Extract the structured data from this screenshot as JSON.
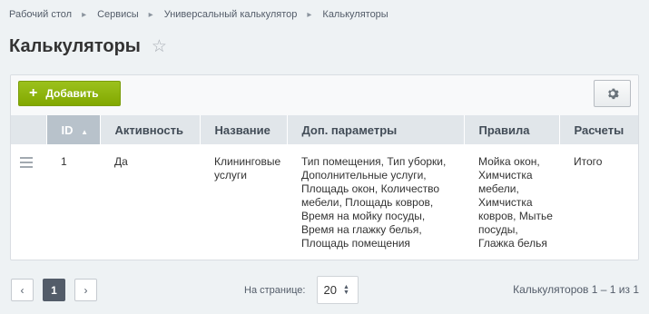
{
  "breadcrumb": [
    "Рабочий стол",
    "Сервисы",
    "Универсальный калькулятор",
    "Калькуляторы"
  ],
  "page_title": "Калькуляторы",
  "toolbar": {
    "add_label": "Добавить"
  },
  "table": {
    "columns": [
      "ID",
      "Активность",
      "Название",
      "Доп. параметры",
      "Правила",
      "Расчеты"
    ],
    "sorted_column": "ID",
    "rows": [
      {
        "id": "1",
        "active": "Да",
        "name": [
          "Клининговые",
          "услуги"
        ],
        "params": [
          "Тип помещения, Тип уборки,",
          "Дополнительные услуги,",
          "Площадь окон, Количество",
          "мебели, Площадь ковров,",
          "Время на мойку посуды,",
          "Время на глажку белья,",
          "Площадь помещения"
        ],
        "rules": [
          "Мойка окон,",
          "Химчистка",
          "мебели,",
          "Химчистка",
          "ковров, Мытье",
          "посуды,",
          "Глажка белья"
        ],
        "calcs": "Итого"
      }
    ]
  },
  "pagination": {
    "prev": "‹",
    "current_page": "1",
    "next": "›",
    "per_page_label": "На странице:",
    "per_page_value": "20",
    "total_text": "Калькуляторов 1 – 1 из 1"
  },
  "colors": {
    "accent_green": "#86ad00",
    "header_bg": "#e1e6ea",
    "sorted_header_bg": "#b8c2cb"
  },
  "icons": [
    "chevron-right-icon",
    "star-icon",
    "plus-icon",
    "gear-icon",
    "sort-up-icon",
    "drag-handle-icon"
  ]
}
